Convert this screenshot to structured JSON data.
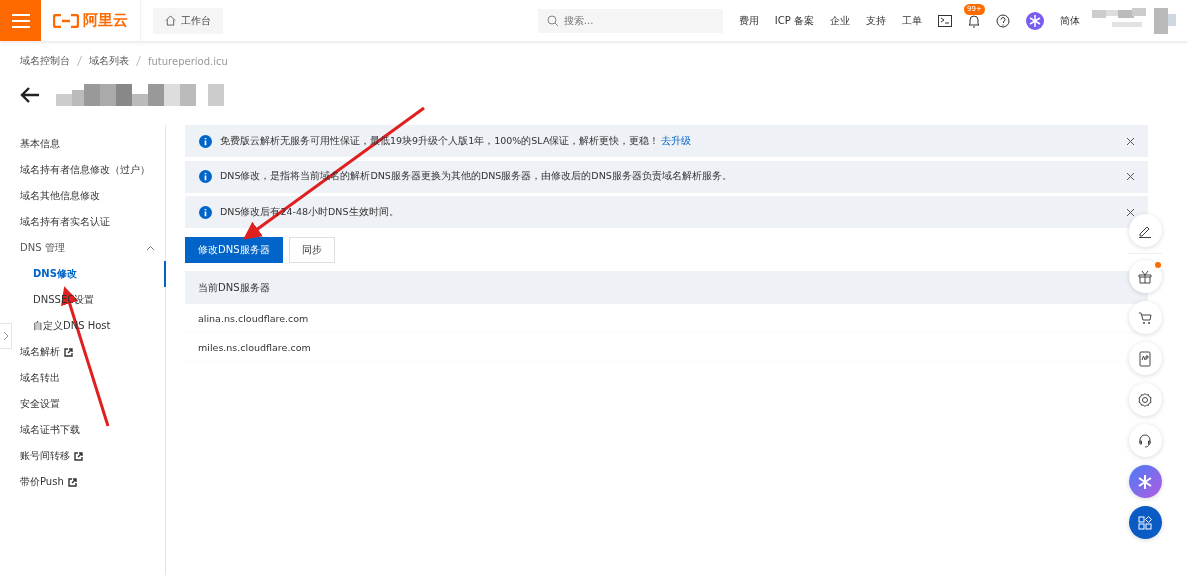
{
  "topbar": {
    "logo": "阿里云",
    "workbench": "工作台",
    "search": {
      "placeholder": "搜索..."
    },
    "links": [
      "费用",
      "ICP 备案",
      "企业",
      "支持",
      "工单"
    ],
    "notification_badge": "99+",
    "language": "简体"
  },
  "breadcrumb": [
    "域名控制台",
    "域名列表",
    "futureperiod.icu"
  ],
  "sidebar": {
    "items": [
      {
        "kind": "item",
        "label": "基本信息",
        "selected": false,
        "external": false
      },
      {
        "kind": "item",
        "label": "域名持有者信息修改（过户）",
        "selected": false,
        "external": false
      },
      {
        "kind": "item",
        "label": "域名其他信息修改",
        "selected": false,
        "external": false
      },
      {
        "kind": "item",
        "label": "域名持有者实名认证",
        "selected": false,
        "external": false
      },
      {
        "kind": "group",
        "label": "DNS 管理",
        "expanded": true,
        "children": [
          {
            "label": "DNS修改",
            "selected": true
          },
          {
            "label": "DNSSEC设置",
            "selected": false
          },
          {
            "label": "自定义DNS Host",
            "selected": false
          }
        ]
      },
      {
        "kind": "item",
        "label": "域名解析",
        "selected": false,
        "external": true
      },
      {
        "kind": "item",
        "label": "域名转出",
        "selected": false,
        "external": false
      },
      {
        "kind": "item",
        "label": "安全设置",
        "selected": false,
        "external": false
      },
      {
        "kind": "item",
        "label": "域名证书下载",
        "selected": false,
        "external": false
      },
      {
        "kind": "item",
        "label": "账号间转移",
        "selected": false,
        "external": true
      },
      {
        "kind": "item",
        "label": "带价Push",
        "selected": false,
        "external": true
      }
    ]
  },
  "notices": [
    {
      "text": "免费版云解析无服务可用性保证，最低19块9升级个人版1年，100%的SLA保证，解析更快，更稳！",
      "link": "去升级"
    },
    {
      "text": "DNS修改，是指将当前域名的解析DNS服务器更换为其他的DNS服务器，由修改后的DNS服务器负责域名解析服务。"
    },
    {
      "text": "DNS修改后有24-48小时DNS生效时间。"
    }
  ],
  "buttons": [
    {
      "label": "修改DNS服务器",
      "kind": "primary"
    },
    {
      "label": "同步",
      "kind": "secondary"
    }
  ],
  "table": {
    "columns": [
      "当前DNS服务器"
    ],
    "rows": [
      "alina.ns.cloudflare.com",
      "miles.ns.cloudflare.com"
    ]
  }
}
